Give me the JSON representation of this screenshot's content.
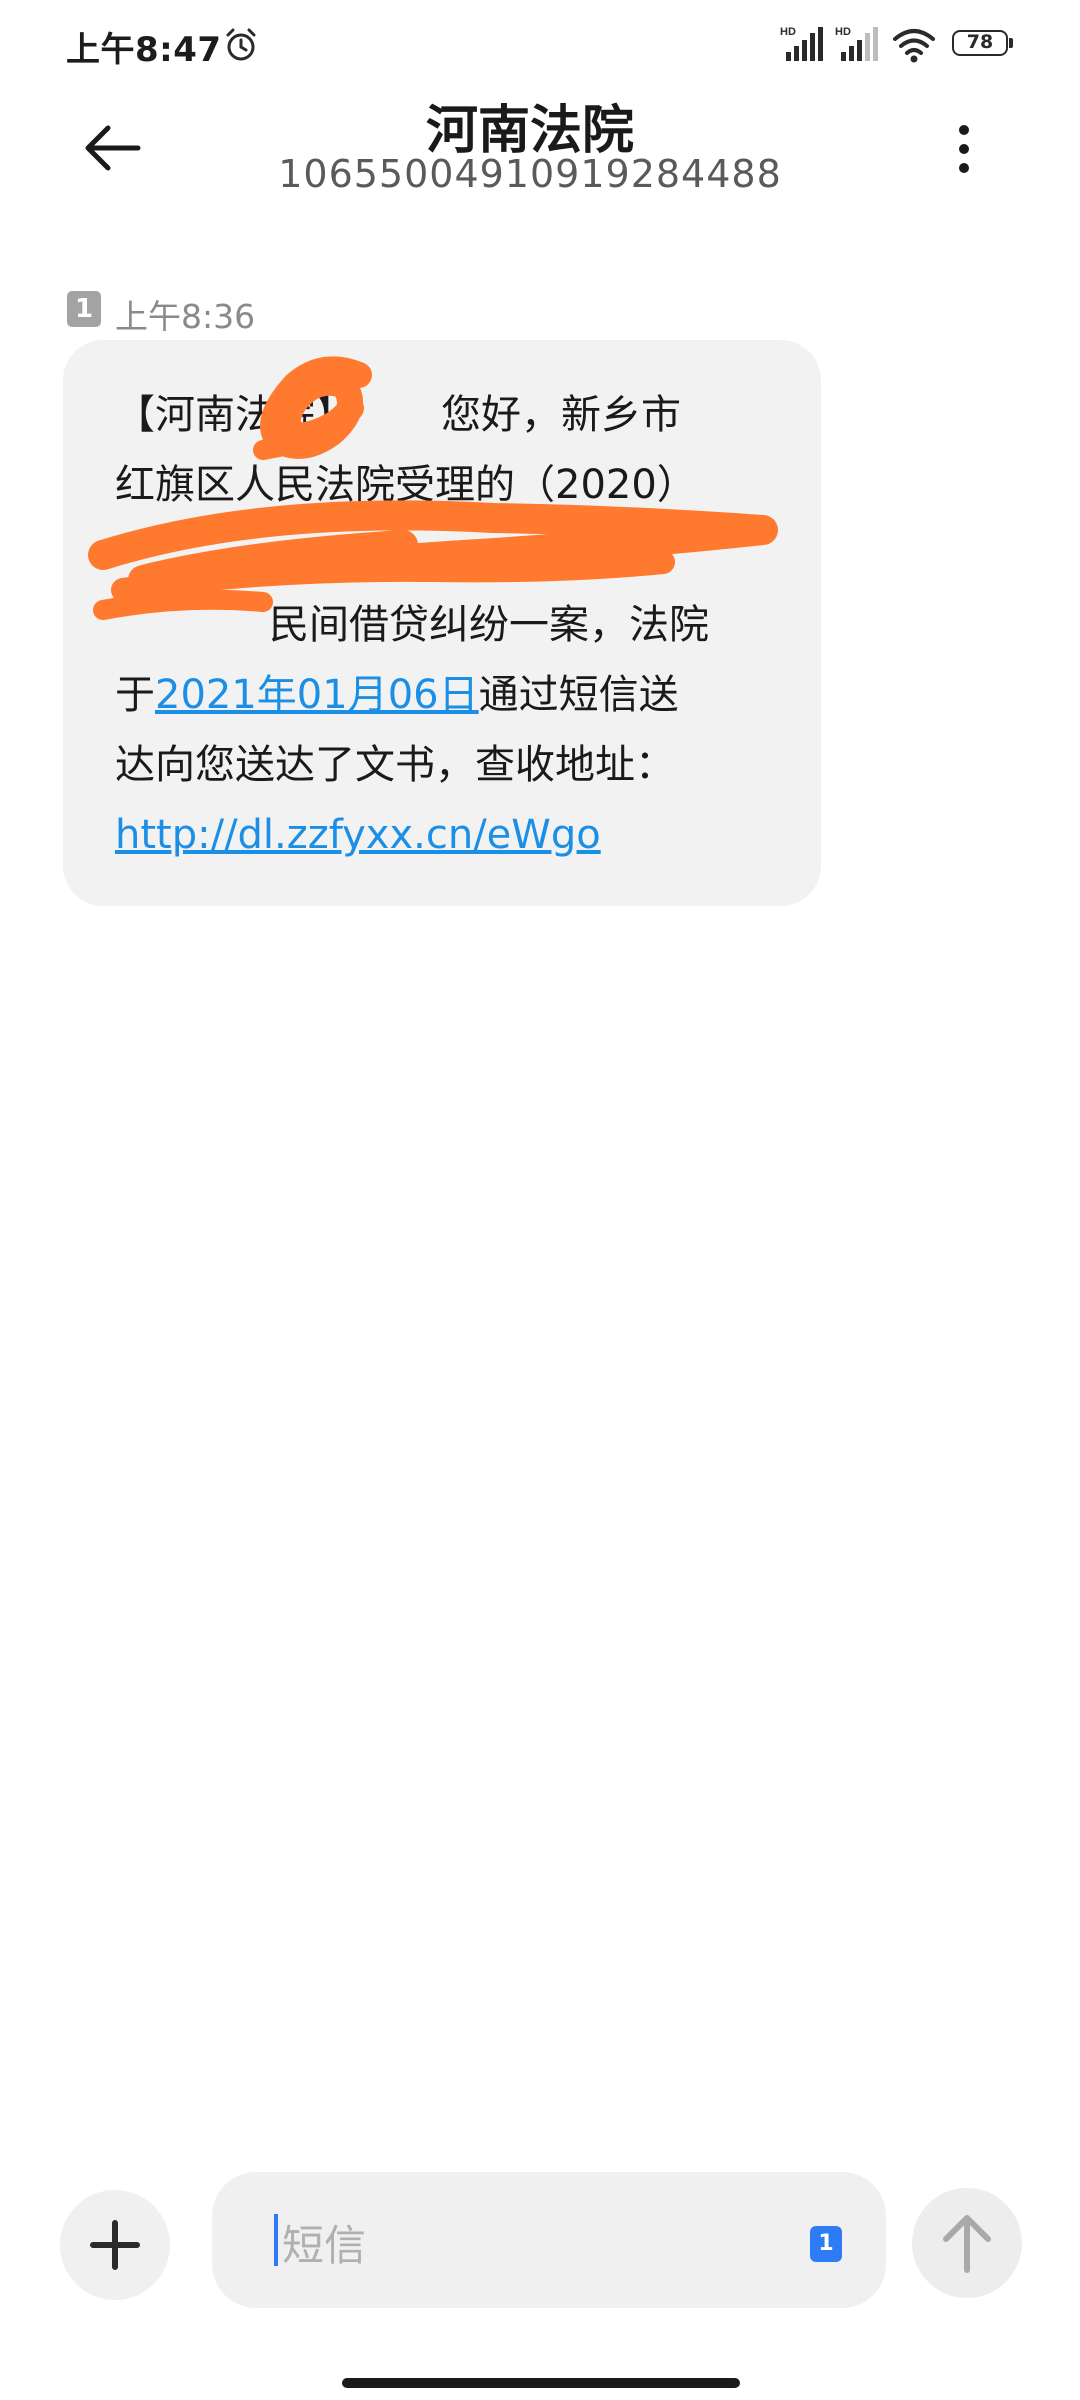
{
  "status_bar": {
    "time": "上午8:47",
    "battery": "78",
    "icons": [
      "alarm-icon",
      "hd-signal-icon",
      "hd-signal-icon",
      "wifi-icon",
      "battery-icon"
    ]
  },
  "header": {
    "title": "河南法院",
    "number": "10655004910919284488",
    "back_icon": "arrow-left-icon",
    "menu_icon": "more-vertical-icon"
  },
  "message": {
    "sim": "1",
    "time": "上午8:36",
    "lines": [
      "【河南法院】",
      "您好，新乡市",
      "红旗区人民法院受理的（2020）",
      "民间借贷纠纷一案，法院",
      "于",
      "2021年01月06日",
      "通过短信送",
      "达向您送达了文书，查收地址：",
      "http://dl.zzfyxx.cn/eWgo"
    ]
  },
  "input_bar": {
    "placeholder": "短信",
    "sim": "1",
    "add_icon": "plus-icon",
    "send_icon": "arrow-up-icon"
  },
  "colors": {
    "link": "#1b8fe6",
    "bubble": "#f2f2f2",
    "redaction": "#ff7a2f",
    "accent": "#2d7cf6"
  }
}
